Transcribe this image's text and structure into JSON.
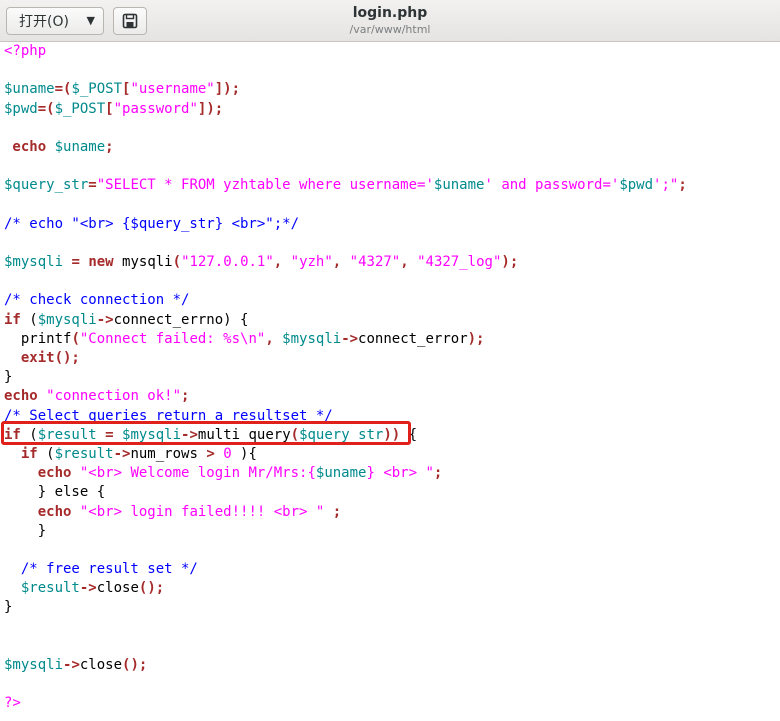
{
  "header": {
    "open_label": "打开(O)",
    "title": "login.php",
    "path": "/var/www/html"
  },
  "code_lines": [
    [
      {
        "t": "<?php",
        "c": "str"
      }
    ],
    [],
    [
      {
        "t": "$uname",
        "c": "var"
      },
      {
        "t": "=(",
        "c": "op"
      },
      {
        "t": "$_POST",
        "c": "var"
      },
      {
        "t": "[",
        "c": "op"
      },
      {
        "t": "\"username\"",
        "c": "str"
      },
      {
        "t": "]);",
        "c": "op"
      }
    ],
    [
      {
        "t": "$pwd",
        "c": "var"
      },
      {
        "t": "=(",
        "c": "op"
      },
      {
        "t": "$_POST",
        "c": "var"
      },
      {
        "t": "[",
        "c": "op"
      },
      {
        "t": "\"password\"",
        "c": "str"
      },
      {
        "t": "]);",
        "c": "op"
      }
    ],
    [],
    [
      {
        "t": " echo",
        "c": "kw"
      },
      {
        "t": " ",
        "c": "txt"
      },
      {
        "t": "$uname",
        "c": "var"
      },
      {
        "t": ";",
        "c": "op"
      }
    ],
    [],
    [
      {
        "t": "$query_str",
        "c": "var"
      },
      {
        "t": "=",
        "c": "op"
      },
      {
        "t": "\"SELECT * FROM yzhtable where username='",
        "c": "str"
      },
      {
        "t": "$uname",
        "c": "var"
      },
      {
        "t": "' and password='",
        "c": "str"
      },
      {
        "t": "$pwd",
        "c": "var"
      },
      {
        "t": "';\"",
        "c": "str"
      },
      {
        "t": ";",
        "c": "op"
      }
    ],
    [],
    [
      {
        "t": "/* echo \"<br> {$query_str} <br>\";*/",
        "c": "cmt"
      }
    ],
    [],
    [
      {
        "t": "$mysqli",
        "c": "var"
      },
      {
        "t": " = ",
        "c": "op"
      },
      {
        "t": "new",
        "c": "kw"
      },
      {
        "t": " mysqli",
        "c": "txt"
      },
      {
        "t": "(",
        "c": "op"
      },
      {
        "t": "\"127.0.0.1\"",
        "c": "str"
      },
      {
        "t": ", ",
        "c": "op"
      },
      {
        "t": "\"yzh\"",
        "c": "str"
      },
      {
        "t": ", ",
        "c": "op"
      },
      {
        "t": "\"4327\"",
        "c": "str"
      },
      {
        "t": ", ",
        "c": "op"
      },
      {
        "t": "\"4327_log\"",
        "c": "str"
      },
      {
        "t": ");",
        "c": "op"
      }
    ],
    [],
    [
      {
        "t": "/* check connection */",
        "c": "cmt"
      }
    ],
    [
      {
        "t": "if",
        "c": "kw"
      },
      {
        "t": " (",
        "c": "txt"
      },
      {
        "t": "$mysqli",
        "c": "var"
      },
      {
        "t": "->",
        "c": "op"
      },
      {
        "t": "connect_errno) {",
        "c": "txt"
      }
    ],
    [
      {
        "t": "  printf",
        "c": "txt"
      },
      {
        "t": "(",
        "c": "op"
      },
      {
        "t": "\"Connect failed: %s\\n\"",
        "c": "str"
      },
      {
        "t": ", ",
        "c": "op"
      },
      {
        "t": "$mysqli",
        "c": "var"
      },
      {
        "t": "->",
        "c": "op"
      },
      {
        "t": "connect_error",
        "c": "txt"
      },
      {
        "t": ");",
        "c": "op"
      }
    ],
    [
      {
        "t": "  exit",
        "c": "kw"
      },
      {
        "t": "();",
        "c": "op"
      }
    ],
    [
      {
        "t": "}",
        "c": "txt"
      }
    ],
    [
      {
        "t": "echo",
        "c": "kw"
      },
      {
        "t": " ",
        "c": "txt"
      },
      {
        "t": "\"connection ok!\"",
        "c": "str"
      },
      {
        "t": ";",
        "c": "op"
      }
    ],
    [
      {
        "t": "/* Select queries return a resultset */",
        "c": "cmt"
      }
    ],
    [
      {
        "t": "if",
        "c": "kw"
      },
      {
        "t": " (",
        "c": "txt"
      },
      {
        "t": "$result",
        "c": "var"
      },
      {
        "t": " = ",
        "c": "op"
      },
      {
        "t": "$mysqli",
        "c": "var"
      },
      {
        "t": "->",
        "c": "op"
      },
      {
        "t": "multi_query",
        "c": "txt"
      },
      {
        "t": "(",
        "c": "op"
      },
      {
        "t": "$query_str",
        "c": "var"
      },
      {
        "t": "))",
        "c": "op"
      },
      {
        "t": " {",
        "c": "txt"
      }
    ],
    [
      {
        "t": "  if",
        "c": "kw"
      },
      {
        "t": " (",
        "c": "txt"
      },
      {
        "t": "$result",
        "c": "var"
      },
      {
        "t": "->",
        "c": "op"
      },
      {
        "t": "num_rows ",
        "c": "txt"
      },
      {
        "t": ">",
        "c": "op"
      },
      {
        "t": " ",
        "c": "txt"
      },
      {
        "t": "0",
        "c": "str"
      },
      {
        "t": " ){",
        "c": "txt"
      }
    ],
    [
      {
        "t": "    echo",
        "c": "kw"
      },
      {
        "t": " ",
        "c": "txt"
      },
      {
        "t": "\"<br> Welcome login Mr/Mrs:{",
        "c": "str"
      },
      {
        "t": "$uname",
        "c": "var"
      },
      {
        "t": "} <br> \"",
        "c": "str"
      },
      {
        "t": ";",
        "c": "op"
      }
    ],
    [
      {
        "t": "    } else {",
        "c": "txt"
      }
    ],
    [
      {
        "t": "    echo",
        "c": "kw"
      },
      {
        "t": " ",
        "c": "txt"
      },
      {
        "t": "\"<br> login failed!!!! <br> \"",
        "c": "str"
      },
      {
        "t": " ;",
        "c": "op"
      }
    ],
    [
      {
        "t": "    }",
        "c": "txt"
      }
    ],
    [],
    [
      {
        "t": "  /* free result set */",
        "c": "cmt"
      }
    ],
    [
      {
        "t": "  ",
        "c": "txt"
      },
      {
        "t": "$result",
        "c": "var"
      },
      {
        "t": "->",
        "c": "op"
      },
      {
        "t": "close",
        "c": "txt"
      },
      {
        "t": "();",
        "c": "op"
      }
    ],
    [
      {
        "t": "}",
        "c": "txt"
      }
    ],
    [],
    [],
    [
      {
        "t": "$mysqli",
        "c": "var"
      },
      {
        "t": "->",
        "c": "op"
      },
      {
        "t": "close",
        "c": "txt"
      },
      {
        "t": "();",
        "c": "op"
      }
    ],
    [],
    [
      {
        "t": "?>",
        "c": "str"
      }
    ]
  ],
  "colors": {
    "keyword": "#a52a2a",
    "variable": "#008a8c",
    "string": "#ff00ff",
    "comment": "#0000ff",
    "highlight_box": "#e0201a"
  },
  "icons": {
    "open_dropdown": "chevron-down-icon",
    "save": "save-icon"
  }
}
